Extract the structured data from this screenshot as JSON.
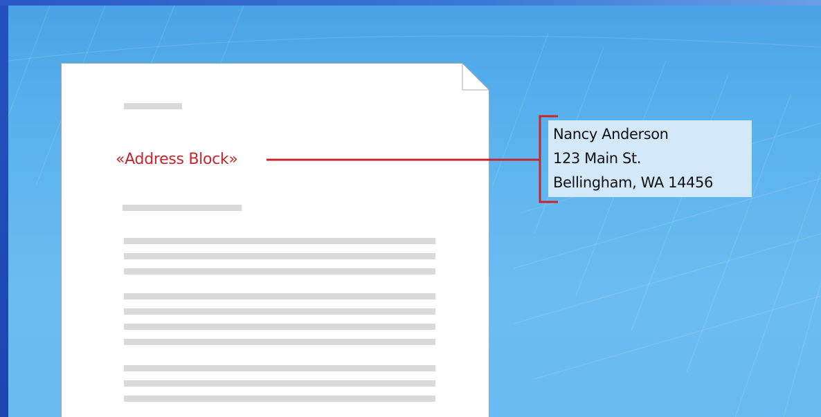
{
  "merge_field": {
    "label": "«Address Block»"
  },
  "address": {
    "lines": [
      "Nancy Anderson",
      "123 Main St.",
      "Bellingham, WA 14456"
    ]
  },
  "colors": {
    "accent_red": "#c6262b",
    "background_blue": "#5cb4ee",
    "frame_blue": "#1a3f9e",
    "placeholder_gray": "#d9d9d9",
    "address_box": "#d3e9f9"
  }
}
